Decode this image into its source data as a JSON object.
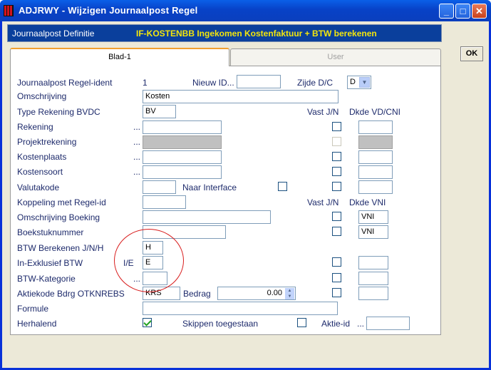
{
  "window": {
    "title": "ADJRWY - Wijzigen Journaalpost Regel",
    "minimize": "_",
    "maximize": "□",
    "close": "✕"
  },
  "header": {
    "label": "Journaalpost Definitie",
    "value": "IF-KOSTENBB  Ingekomen Kostenfaktuur + BTW berekenen"
  },
  "tabs": [
    "Blad-1",
    "User"
  ],
  "ok_label": "OK",
  "labels": {
    "regel_ident": "Journaalpost Regel-ident",
    "nieuw_id": "Nieuw ID...",
    "zijde": "Zijde D/C",
    "omschrijving": "Omschrijving",
    "type_rekening": "Type Rekening BVDC",
    "vast_jn_1": "Vast J/N",
    "dkde_vd_cni": "Dkde VD/CNI",
    "rekening": "Rekening",
    "projektrekening": "Projektrekening",
    "kostenplaats": "Kostenplaats",
    "kostensoort": "Kostensoort",
    "valutakode": "Valutakode",
    "naar_interface": "Naar Interface",
    "koppeling": "Koppeling met Regel-id",
    "vast_jn_2": "Vast J/N",
    "dkde_vni": "Dkde VNI",
    "omschrijving_boeking": "Omschrijving Boeking",
    "boekstuknummer": "Boekstuknummer",
    "btw_berekenen": "BTW Berekenen J/N/H",
    "in_exklusief": "In-Exklusief BTW",
    "ie": "I/E",
    "btw_kategorie": "BTW-Kategorie",
    "aktiekode": "Aktiekode Bdrg  OTKNREBS",
    "bedrag": "Bedrag",
    "formule": "Formule",
    "herhalend": "Herhalend",
    "skippen": "Skippen toegestaan",
    "aktie_id": "Aktie-id",
    "dots": "..."
  },
  "values": {
    "regel_ident": "1",
    "nieuw_id": "",
    "zijde": "D",
    "omschrijving": "Kosten",
    "type_rekening": "BV",
    "dkde_boeking": "VNI",
    "dkde_boekstuk": "VNI",
    "btw_berekenen": "H",
    "in_exklusief": "E",
    "aktiekode": "KRS",
    "bedrag": "0.00"
  },
  "checkboxes": {
    "herhalend": true,
    "skippen": false,
    "naar_interface": false
  }
}
